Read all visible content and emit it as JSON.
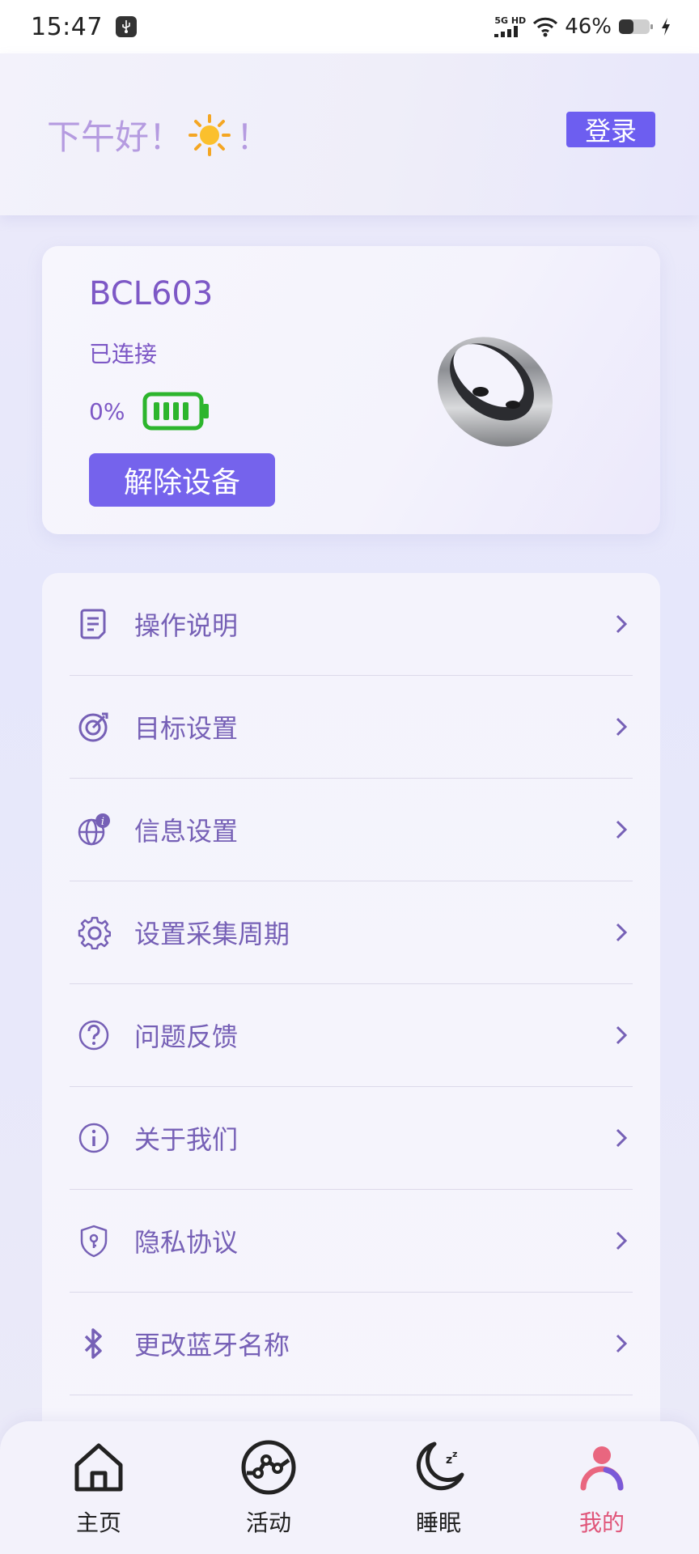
{
  "status_bar": {
    "time": "15:47",
    "network": "5G HD",
    "battery_percent": "46%"
  },
  "header": {
    "greeting": "下午好！",
    "greeting_suffix": "！",
    "login_label": "登录"
  },
  "device": {
    "name": "BCL603",
    "status": "已连接",
    "battery": "0%",
    "unbind_label": "解除设备"
  },
  "menu": {
    "items": [
      {
        "label": "操作说明",
        "icon": "document-icon"
      },
      {
        "label": "目标设置",
        "icon": "target-icon"
      },
      {
        "label": "信息设置",
        "icon": "globe-info-icon"
      },
      {
        "label": "设置采集周期",
        "icon": "gear-icon"
      },
      {
        "label": "问题反馈",
        "icon": "help-icon"
      },
      {
        "label": "关于我们",
        "icon": "info-icon"
      },
      {
        "label": "隐私协议",
        "icon": "shield-key-icon"
      },
      {
        "label": "更改蓝牙名称",
        "icon": "bluetooth-icon"
      }
    ]
  },
  "tabs": [
    {
      "label": "主页",
      "icon": "home-icon"
    },
    {
      "label": "活动",
      "icon": "activity-icon"
    },
    {
      "label": "睡眠",
      "icon": "moon-icon"
    },
    {
      "label": "我的",
      "icon": "person-icon",
      "active": true
    }
  ],
  "colors": {
    "accent": "#6d5ef0",
    "text_purple": "#7660b6",
    "active_tab": "#e0567a",
    "battery_green": "#2db52d"
  }
}
